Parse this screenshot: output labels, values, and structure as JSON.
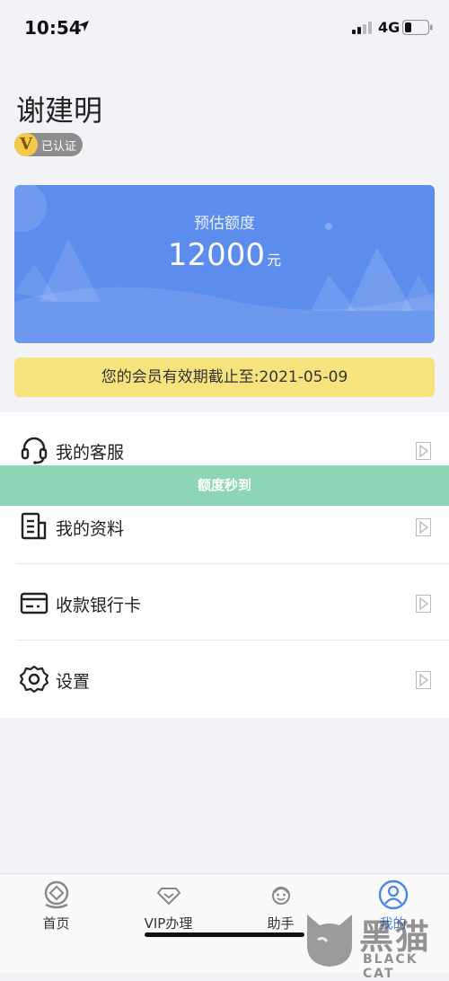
{
  "status_bar": {
    "time": "10:54",
    "network": "4G"
  },
  "profile": {
    "name": "谢建明",
    "badge_letter": "V",
    "badge_label": "已认证"
  },
  "credit_card": {
    "label": "预估额度",
    "amount": "12000",
    "unit": "元"
  },
  "membership": {
    "text": "您的会员有效期截止至:2021-05-09"
  },
  "toast": {
    "text": "额度秒到"
  },
  "menu": {
    "items": [
      {
        "label": "我的客服",
        "icon": "headset-icon"
      },
      {
        "label": "我的资料",
        "icon": "document-icon"
      },
      {
        "label": "收款银行卡",
        "icon": "bank-card-icon"
      },
      {
        "label": "设置",
        "icon": "gear-icon"
      }
    ]
  },
  "tabbar": {
    "tabs": [
      {
        "label": "首页",
        "icon": "home-icon"
      },
      {
        "label": "VIP办理",
        "icon": "diamond-icon"
      },
      {
        "label": "助手",
        "icon": "assistant-icon"
      },
      {
        "label": "我的",
        "icon": "user-icon"
      }
    ]
  },
  "watermark": {
    "cn": "黑猫",
    "en": "BLACK CAT"
  },
  "colors": {
    "card_blue": "#5c8ded",
    "vip_yellow": "#f7e37d",
    "toast_green": "#86d3b3",
    "active_tab": "#4a86e8"
  }
}
